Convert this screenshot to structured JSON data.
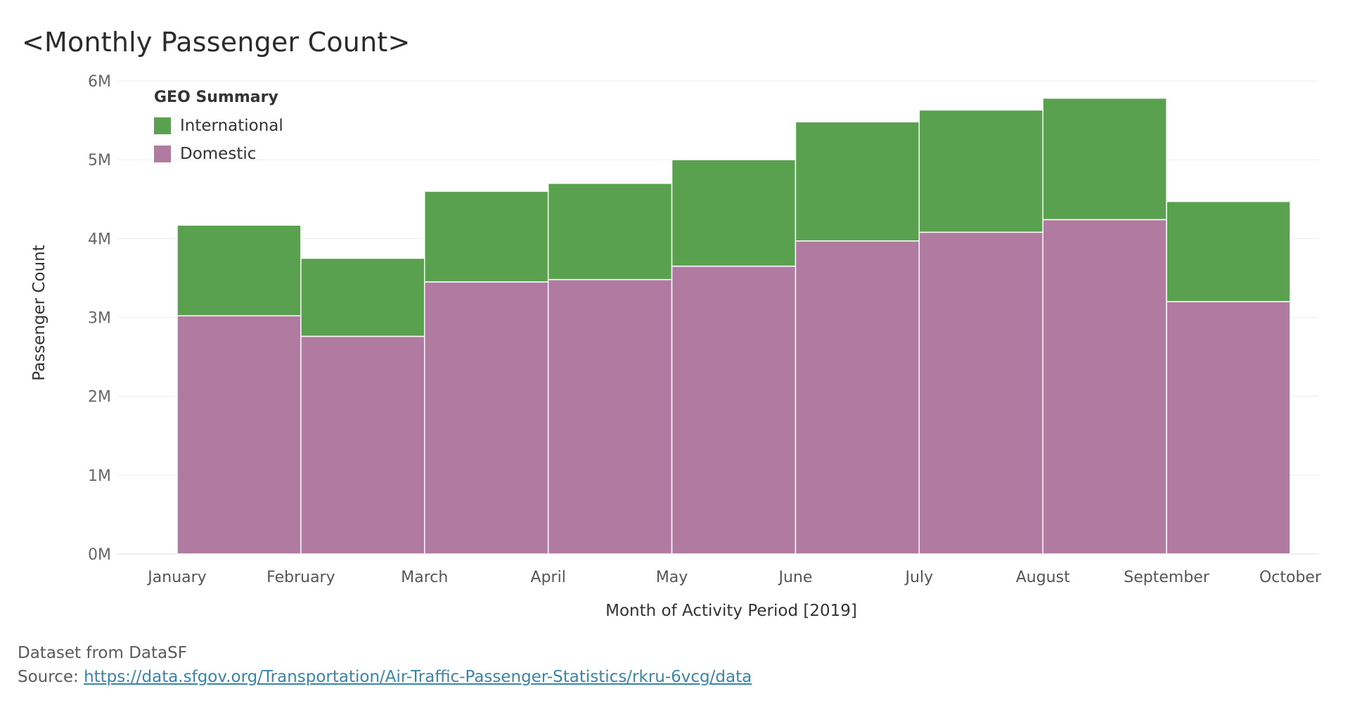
{
  "title": "<Monthly Passenger Count>",
  "chart_data": {
    "type": "bar",
    "stacked": true,
    "categories": [
      "January",
      "February",
      "March",
      "April",
      "May",
      "June",
      "July",
      "August",
      "September",
      "October"
    ],
    "series": [
      {
        "name": "Domestic",
        "color": "#b07aa1",
        "values": [
          3020000,
          2760000,
          3450000,
          3480000,
          3650000,
          3970000,
          4080000,
          4240000,
          3200000,
          null
        ]
      },
      {
        "name": "International",
        "color": "#59a14f",
        "values": [
          1150000,
          990000,
          1150000,
          1220000,
          1350000,
          1510000,
          1550000,
          1540000,
          1270000,
          null
        ]
      }
    ],
    "xlabel": "Month of Activity Period [2019]",
    "ylabel": "Passenger Count",
    "ylim": [
      0,
      6000000
    ],
    "yticks": [
      "0M",
      "1M",
      "2M",
      "3M",
      "4M",
      "5M",
      "6M"
    ],
    "grid": true,
    "legend": {
      "title": "GEO Summary",
      "position": "top-left",
      "items": [
        "International",
        "Domestic"
      ]
    }
  },
  "footer": {
    "dataset_text": "Dataset from DataSF",
    "source_label": "Source: ",
    "source_link": "https://data.sfgov.org/Transportation/Air-Traffic-Passenger-Statistics/rkru-6vcg/data"
  }
}
